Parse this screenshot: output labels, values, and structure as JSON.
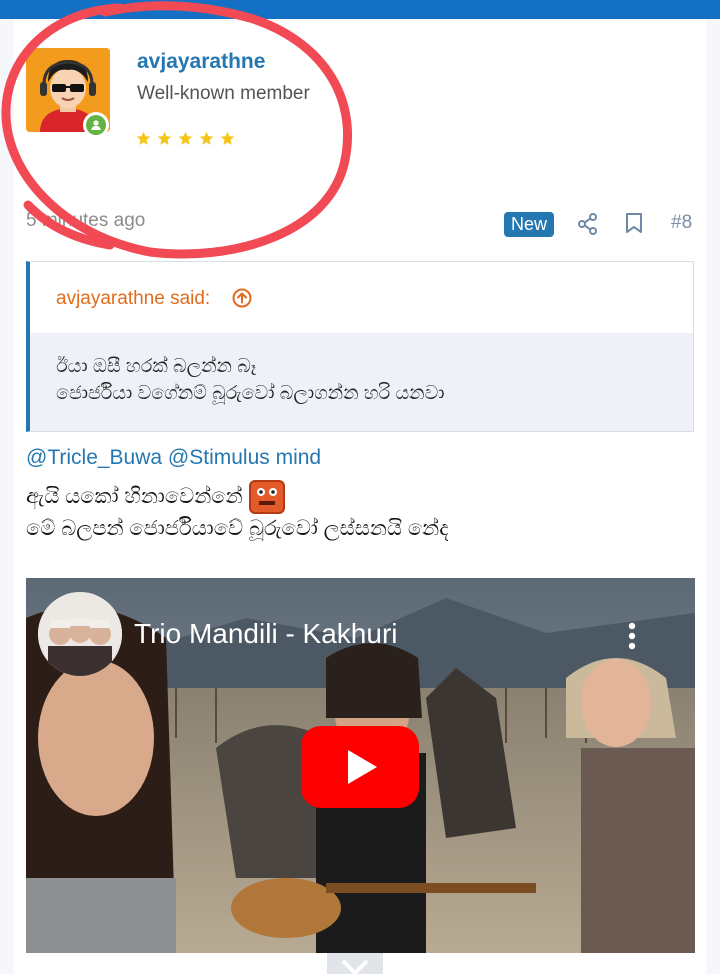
{
  "post": {
    "username": "avjayarathne",
    "user_title": "Well-known member",
    "stars": 5,
    "time": "5 minutes ago",
    "badge": "New",
    "post_number": "#8"
  },
  "quote": {
    "author": "avjayarathne said:",
    "lines": [
      "ඊයා ඔසී හරක් බලන්න බෑ",
      "ජොර්ජියා වගේනම් බූරුවෝ බලාගන්න හරි යනවා"
    ]
  },
  "message": {
    "mentions": "@Tricle_Buwa @Stimulus mind",
    "line1": "ඇයි යකෝ හිනාවෙන්නේ",
    "line2": "මේ බලපන් ජොර්ජියාවේ බූරුවෝ ලස්සනයි නේද"
  },
  "video": {
    "title": "Trio Mandili - Kakhuri"
  },
  "icons": {
    "share": "share-icon",
    "bookmark": "bookmark-icon",
    "quote_up": "arrow-up-circle-icon",
    "play": "youtube-play-icon",
    "more": "more-vertical-icon",
    "collapse": "chevron-down-icon"
  },
  "colors": {
    "brand": "#1470c4",
    "link": "#2577b1",
    "quote_author": "#e06c1e",
    "star": "#f5c518",
    "online": "#63b345",
    "youtube": "#ff0000",
    "annotation": "#f14a55"
  }
}
